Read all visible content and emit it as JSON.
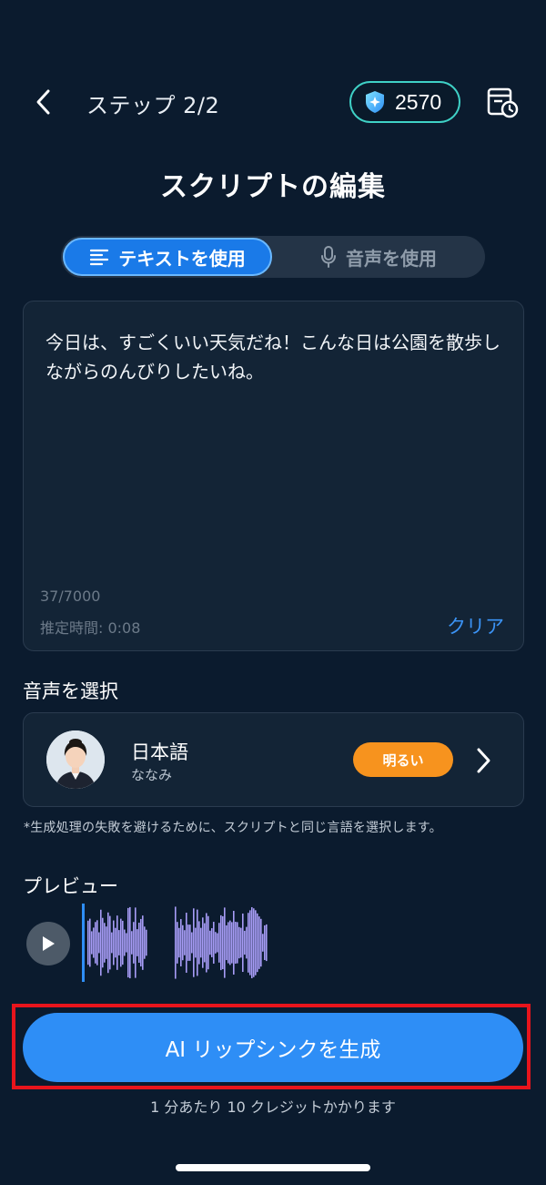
{
  "header": {
    "step_label": "ステップ 2/2",
    "credits": "2570"
  },
  "page_title": "スクリプトの編集",
  "mode_tabs": [
    {
      "label": "テキストを使用",
      "active": true,
      "icon": "text-lines-icon"
    },
    {
      "label": "音声を使用",
      "active": false,
      "icon": "microphone-icon"
    }
  ],
  "script": {
    "text": "今日は、すごくいい天気だね！こんな日は公園を散歩しながらのんびりしたいね。",
    "char_count": "37/7000",
    "estimated_time": "推定時間: 0:08",
    "clear_label": "クリア"
  },
  "voice_section": {
    "label": "音声を選択",
    "language": "日本語",
    "voice_name": "ななみ",
    "tone_badge": "明るい",
    "hint": "*生成処理の失敗を避けるために、スクリプトと同じ言語を選択します。"
  },
  "preview": {
    "label": "プレビュー"
  },
  "generate": {
    "label": "AI リップシンクを生成",
    "cost_note": "1 分あたり 10 クレジットかかります"
  },
  "colors": {
    "background": "#0b1b2e",
    "accent": "#2e8ef6",
    "badge_orange": "#f7931e",
    "highlight_red": "#e8141c",
    "credit_border": "#3fd1c6",
    "waveform": "#a79cf6"
  }
}
